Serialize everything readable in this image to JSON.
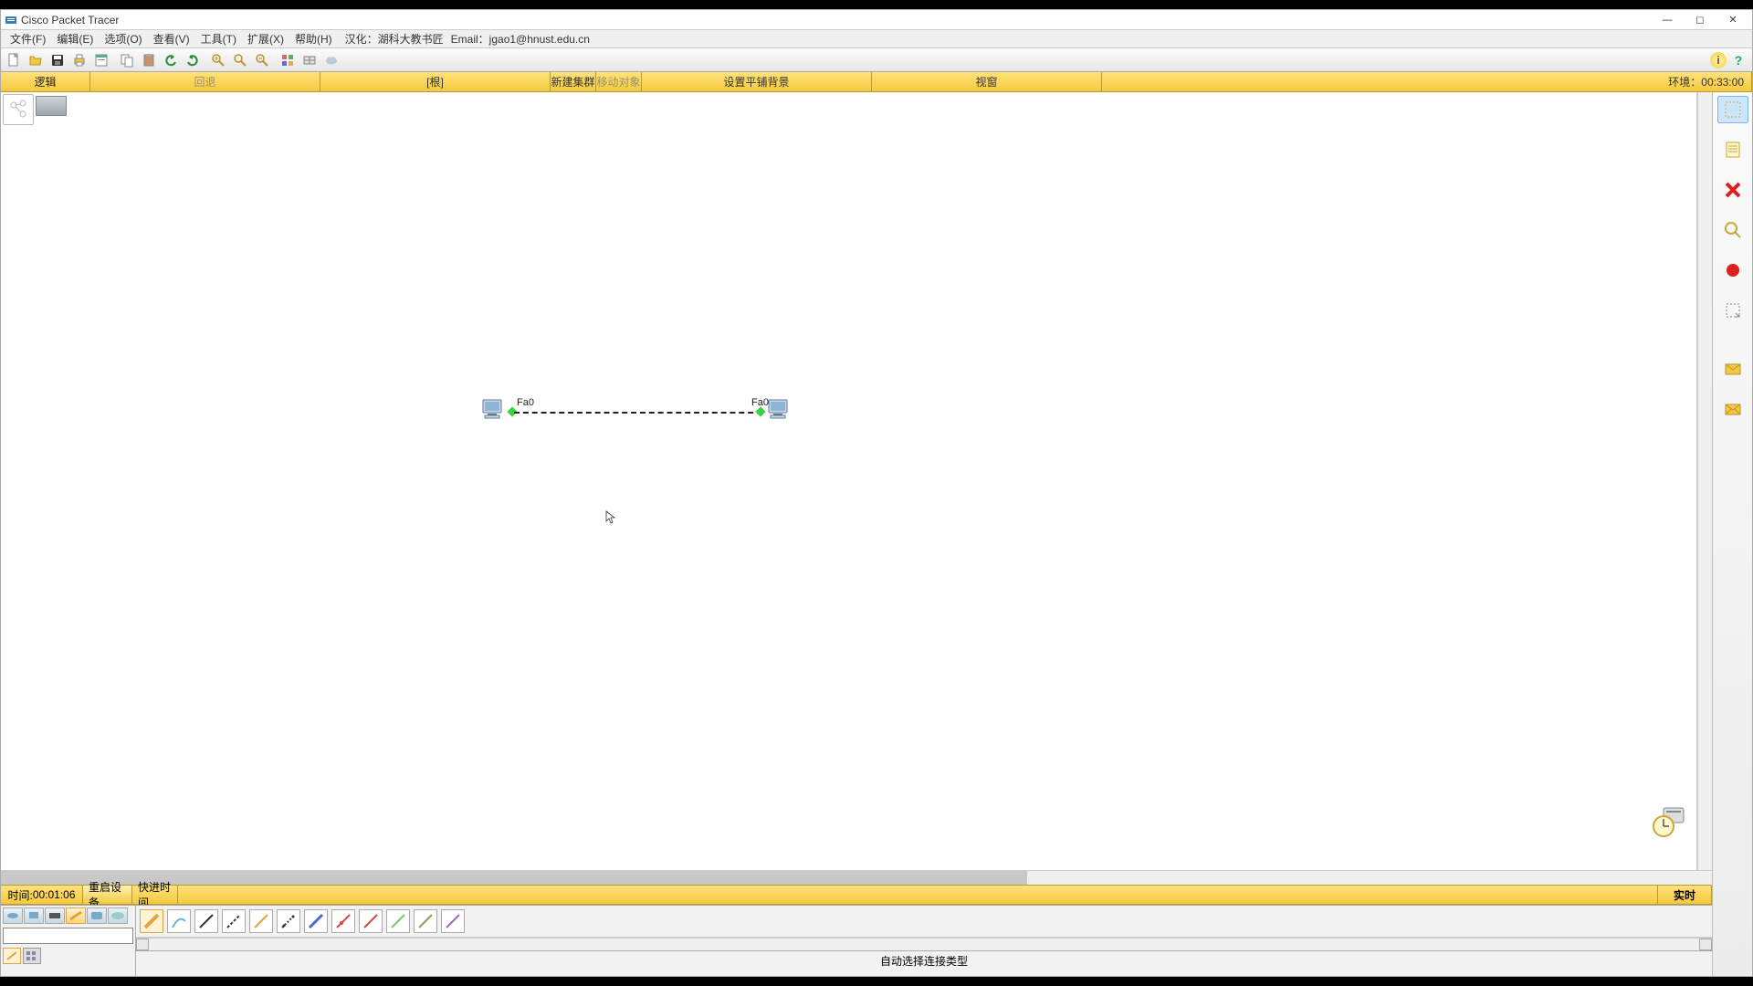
{
  "window": {
    "title": "Cisco Packet Tracer"
  },
  "menu": {
    "file": "文件(F)",
    "edit": "编辑(E)",
    "options": "选项(O)",
    "view": "查看(V)",
    "tools": "工具(T)",
    "extensions": "扩展(X)",
    "help": "帮助(H)",
    "translation": "汉化：湖科大教书匠",
    "email": "Email：jgao1@hnust.edu.cn"
  },
  "secondbar": {
    "logic": "逻辑",
    "back": "回退",
    "root": "[根]",
    "new_cluster": "新建集群",
    "move_obj": "移动对象",
    "set_bg": "设置平铺背景",
    "viewport": "视窗",
    "env_label": "环境：",
    "env_time": "00:33:00"
  },
  "workspace": {
    "port_left": "Fa0",
    "port_right": "Fa0"
  },
  "timebar": {
    "time_label": "时间:",
    "time_value": "00:01:06",
    "reset": "重启设备",
    "fast": "快进时间",
    "mode": "实时"
  },
  "status": {
    "text": "自动选择连接类型"
  }
}
